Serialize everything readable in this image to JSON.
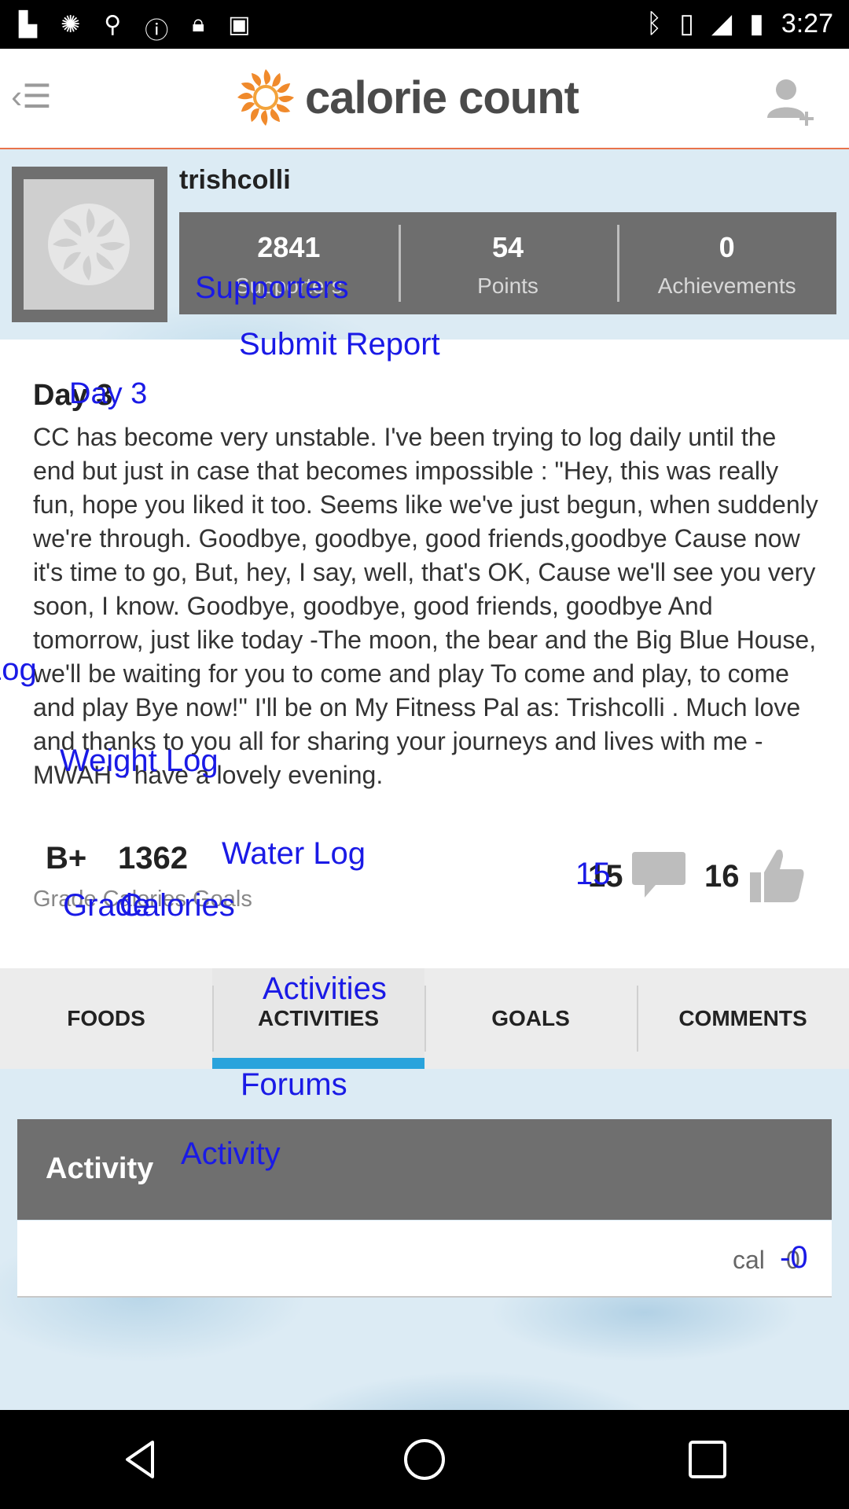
{
  "status_bar": {
    "time": "3:27",
    "left_icons": [
      "notification-icon",
      "pinwheel-icon",
      "fake-gps-icon",
      "info-icon",
      "lock-icon",
      "android-icon"
    ],
    "right_icons": [
      "bluetooth-icon",
      "vibrate-icon",
      "signal-icon",
      "battery-icon"
    ]
  },
  "app_bar": {
    "title": "calorie count"
  },
  "profile": {
    "username": "trishcolli",
    "stats": [
      {
        "value": "2841",
        "label": "Supporters"
      },
      {
        "value": "54",
        "label": "Points"
      },
      {
        "value": "0",
        "label": "Achievements"
      }
    ]
  },
  "report": {
    "day_title": "Day 3",
    "body": "CC has become very unstable. I've been trying to log daily until the end but just in case that becomes impossible : \"Hey, this was really fun, hope you liked it too. Seems like we've just begun, when suddenly we're through. Goodbye, goodbye, good friends,goodbye Cause now it's time to go, But, hey, I say, well, that's OK, Cause we'll see you very soon, I know. Goodbye, goodbye, good friends, goodbye And tomorrow, just like today -The moon, the bear and the Big Blue House, we'll be waiting for you to come and play To come and play, to come and play Bye now!\" I'll be on My Fitness Pal as: Trishcolli . Much love and thanks to you all for sharing your journeys and lives with me - MWAH - have a lovely evening.",
    "grade": "B+",
    "calories": "1362",
    "labels_line": "Grade Calories Goals",
    "comment_count": "15",
    "like_count": "16"
  },
  "tabs": [
    {
      "label": "FOODS"
    },
    {
      "label": "ACTIVITIES"
    },
    {
      "label": "GOALS"
    },
    {
      "label": "COMMENTS"
    }
  ],
  "activity_table": {
    "header": "Activity",
    "unit": "cal",
    "value": "0"
  },
  "overlay_labels": {
    "supporters": "Supporters",
    "submit_report": "Submit Report",
    "day": "Day 3",
    "log": "Log",
    "weight_log": "Weight Log",
    "water_log": "Water Log",
    "grade": "Grade",
    "calories": "Calories",
    "comments_num": "15",
    "activities": "Activities",
    "forums": "Forums",
    "activity": "Activity",
    "minus_zero": "-0"
  },
  "colors": {
    "accent_orange": "#e8734a",
    "tab_underline": "#29a3dc",
    "stats_bg": "#6e6e6e",
    "overlay_blue": "#1a1ae6"
  }
}
